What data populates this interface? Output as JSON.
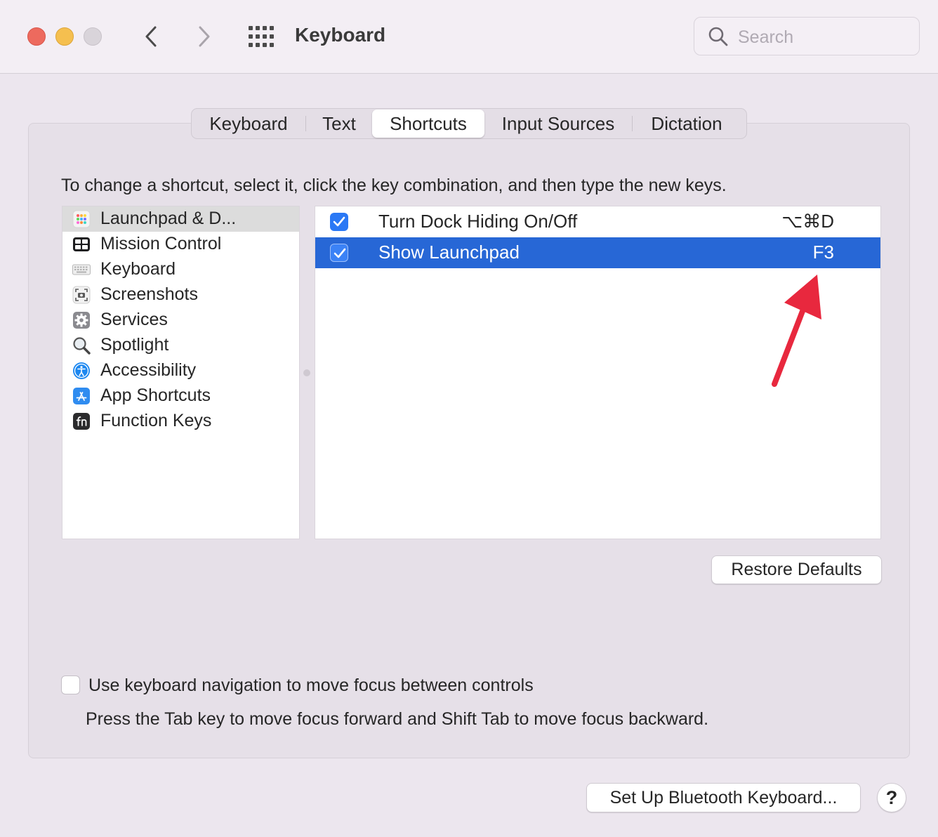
{
  "window": {
    "title": "Keyboard",
    "search_placeholder": "Search",
    "search_value": "",
    "traffic_lights": [
      "close",
      "minimize",
      "zoom"
    ]
  },
  "tabs": [
    {
      "label": "Keyboard",
      "active": false
    },
    {
      "label": "Text",
      "active": false
    },
    {
      "label": "Shortcuts",
      "active": true
    },
    {
      "label": "Input Sources",
      "active": false
    },
    {
      "label": "Dictation",
      "active": false
    }
  ],
  "instructions": "To change a shortcut, select it, click the key combination, and then type the new keys.",
  "categories": [
    {
      "label": "Launchpad & D...",
      "icon": "launchpad-icon",
      "selected": true
    },
    {
      "label": "Mission Control",
      "icon": "mission-control-icon",
      "selected": false
    },
    {
      "label": "Keyboard",
      "icon": "keyboard-icon",
      "selected": false
    },
    {
      "label": "Screenshots",
      "icon": "screenshot-icon",
      "selected": false
    },
    {
      "label": "Services",
      "icon": "gear-icon",
      "selected": false
    },
    {
      "label": "Spotlight",
      "icon": "magnifier-icon",
      "selected": false
    },
    {
      "label": "Accessibility",
      "icon": "accessibility-icon",
      "selected": false
    },
    {
      "label": "App Shortcuts",
      "icon": "app-store-icon",
      "selected": false
    },
    {
      "label": "Function Keys",
      "icon": "fn-key-icon",
      "selected": false
    }
  ],
  "shortcuts": [
    {
      "label": "Turn Dock Hiding On/Off",
      "key": "⌥⌘D",
      "checked": true,
      "selected": false
    },
    {
      "label": "Show Launchpad",
      "key": "F3",
      "checked": true,
      "selected": true
    }
  ],
  "buttons": {
    "restore_defaults": "Restore Defaults",
    "bluetooth": "Set Up Bluetooth Keyboard...",
    "help": "?"
  },
  "keyboard_navigation": {
    "label": "Use keyboard navigation to move focus between controls",
    "checked": false,
    "hint": "Press the Tab key to move focus forward and Shift Tab to move focus backward."
  },
  "colors": {
    "accent": "#2767d6",
    "checkbox": "#2a78f5",
    "annotation_arrow": "#e8283e"
  }
}
